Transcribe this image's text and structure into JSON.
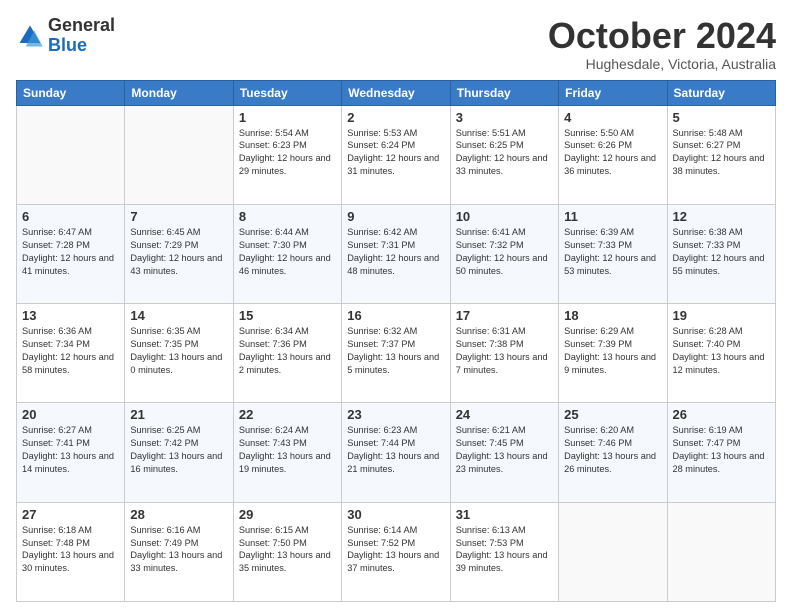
{
  "header": {
    "logo_general": "General",
    "logo_blue": "Blue",
    "month_title": "October 2024",
    "location": "Hughesdale, Victoria, Australia"
  },
  "days_of_week": [
    "Sunday",
    "Monday",
    "Tuesday",
    "Wednesday",
    "Thursday",
    "Friday",
    "Saturday"
  ],
  "weeks": [
    [
      {
        "day": "",
        "info": ""
      },
      {
        "day": "",
        "info": ""
      },
      {
        "day": "1",
        "info": "Sunrise: 5:54 AM\nSunset: 6:23 PM\nDaylight: 12 hours and 29 minutes."
      },
      {
        "day": "2",
        "info": "Sunrise: 5:53 AM\nSunset: 6:24 PM\nDaylight: 12 hours and 31 minutes."
      },
      {
        "day": "3",
        "info": "Sunrise: 5:51 AM\nSunset: 6:25 PM\nDaylight: 12 hours and 33 minutes."
      },
      {
        "day": "4",
        "info": "Sunrise: 5:50 AM\nSunset: 6:26 PM\nDaylight: 12 hours and 36 minutes."
      },
      {
        "day": "5",
        "info": "Sunrise: 5:48 AM\nSunset: 6:27 PM\nDaylight: 12 hours and 38 minutes."
      }
    ],
    [
      {
        "day": "6",
        "info": "Sunrise: 6:47 AM\nSunset: 7:28 PM\nDaylight: 12 hours and 41 minutes."
      },
      {
        "day": "7",
        "info": "Sunrise: 6:45 AM\nSunset: 7:29 PM\nDaylight: 12 hours and 43 minutes."
      },
      {
        "day": "8",
        "info": "Sunrise: 6:44 AM\nSunset: 7:30 PM\nDaylight: 12 hours and 46 minutes."
      },
      {
        "day": "9",
        "info": "Sunrise: 6:42 AM\nSunset: 7:31 PM\nDaylight: 12 hours and 48 minutes."
      },
      {
        "day": "10",
        "info": "Sunrise: 6:41 AM\nSunset: 7:32 PM\nDaylight: 12 hours and 50 minutes."
      },
      {
        "day": "11",
        "info": "Sunrise: 6:39 AM\nSunset: 7:33 PM\nDaylight: 12 hours and 53 minutes."
      },
      {
        "day": "12",
        "info": "Sunrise: 6:38 AM\nSunset: 7:33 PM\nDaylight: 12 hours and 55 minutes."
      }
    ],
    [
      {
        "day": "13",
        "info": "Sunrise: 6:36 AM\nSunset: 7:34 PM\nDaylight: 12 hours and 58 minutes."
      },
      {
        "day": "14",
        "info": "Sunrise: 6:35 AM\nSunset: 7:35 PM\nDaylight: 13 hours and 0 minutes."
      },
      {
        "day": "15",
        "info": "Sunrise: 6:34 AM\nSunset: 7:36 PM\nDaylight: 13 hours and 2 minutes."
      },
      {
        "day": "16",
        "info": "Sunrise: 6:32 AM\nSunset: 7:37 PM\nDaylight: 13 hours and 5 minutes."
      },
      {
        "day": "17",
        "info": "Sunrise: 6:31 AM\nSunset: 7:38 PM\nDaylight: 13 hours and 7 minutes."
      },
      {
        "day": "18",
        "info": "Sunrise: 6:29 AM\nSunset: 7:39 PM\nDaylight: 13 hours and 9 minutes."
      },
      {
        "day": "19",
        "info": "Sunrise: 6:28 AM\nSunset: 7:40 PM\nDaylight: 13 hours and 12 minutes."
      }
    ],
    [
      {
        "day": "20",
        "info": "Sunrise: 6:27 AM\nSunset: 7:41 PM\nDaylight: 13 hours and 14 minutes."
      },
      {
        "day": "21",
        "info": "Sunrise: 6:25 AM\nSunset: 7:42 PM\nDaylight: 13 hours and 16 minutes."
      },
      {
        "day": "22",
        "info": "Sunrise: 6:24 AM\nSunset: 7:43 PM\nDaylight: 13 hours and 19 minutes."
      },
      {
        "day": "23",
        "info": "Sunrise: 6:23 AM\nSunset: 7:44 PM\nDaylight: 13 hours and 21 minutes."
      },
      {
        "day": "24",
        "info": "Sunrise: 6:21 AM\nSunset: 7:45 PM\nDaylight: 13 hours and 23 minutes."
      },
      {
        "day": "25",
        "info": "Sunrise: 6:20 AM\nSunset: 7:46 PM\nDaylight: 13 hours and 26 minutes."
      },
      {
        "day": "26",
        "info": "Sunrise: 6:19 AM\nSunset: 7:47 PM\nDaylight: 13 hours and 28 minutes."
      }
    ],
    [
      {
        "day": "27",
        "info": "Sunrise: 6:18 AM\nSunset: 7:48 PM\nDaylight: 13 hours and 30 minutes."
      },
      {
        "day": "28",
        "info": "Sunrise: 6:16 AM\nSunset: 7:49 PM\nDaylight: 13 hours and 33 minutes."
      },
      {
        "day": "29",
        "info": "Sunrise: 6:15 AM\nSunset: 7:50 PM\nDaylight: 13 hours and 35 minutes."
      },
      {
        "day": "30",
        "info": "Sunrise: 6:14 AM\nSunset: 7:52 PM\nDaylight: 13 hours and 37 minutes."
      },
      {
        "day": "31",
        "info": "Sunrise: 6:13 AM\nSunset: 7:53 PM\nDaylight: 13 hours and 39 minutes."
      },
      {
        "day": "",
        "info": ""
      },
      {
        "day": "",
        "info": ""
      }
    ]
  ]
}
